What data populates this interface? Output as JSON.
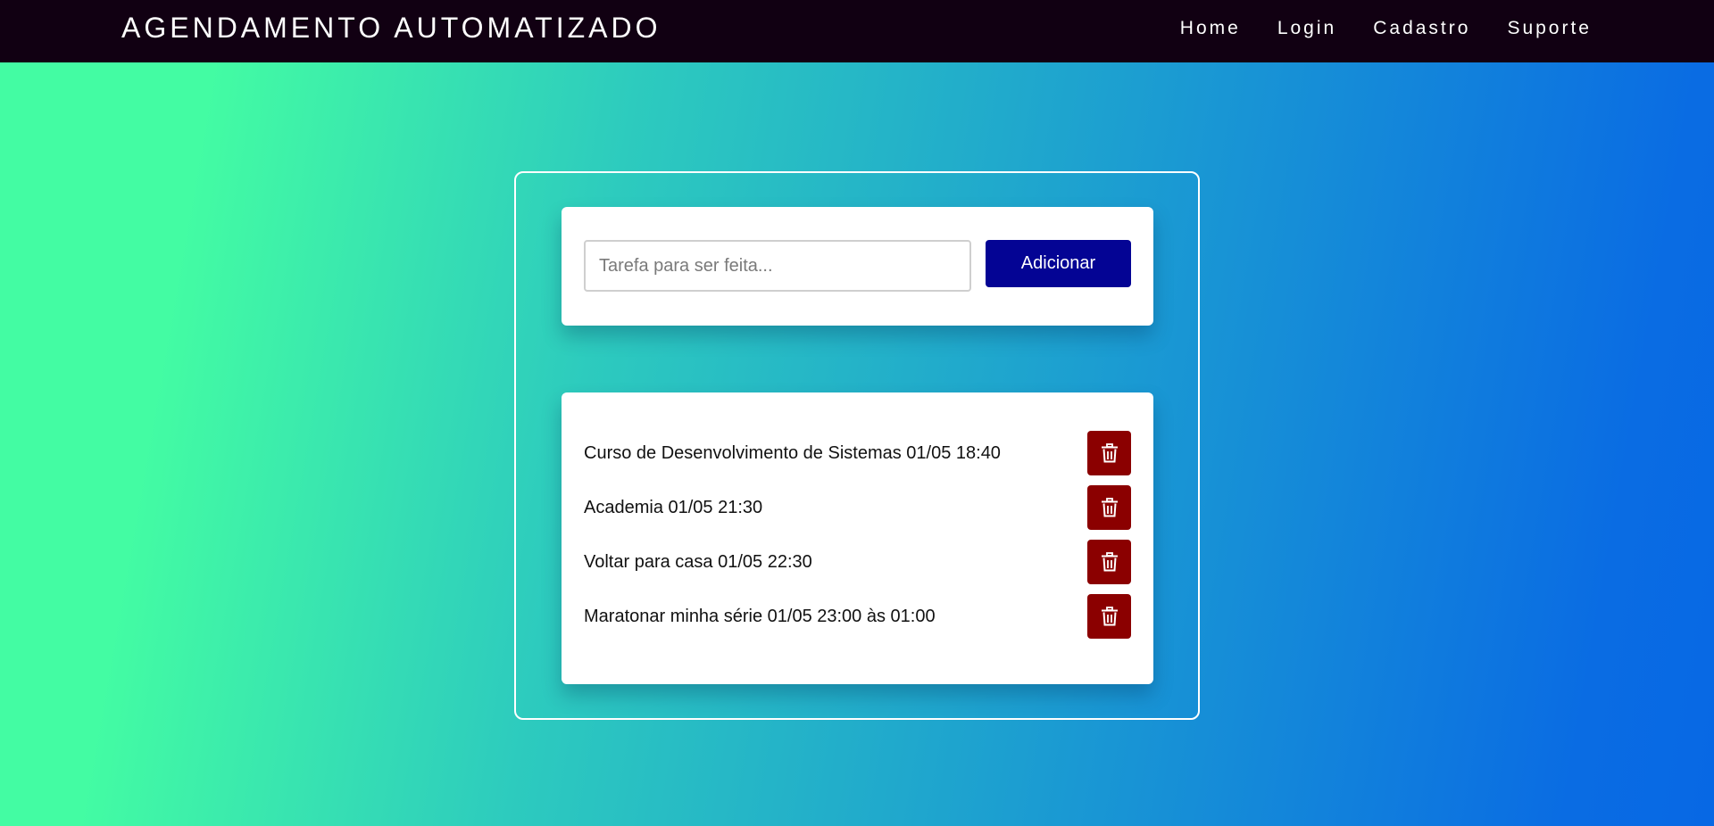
{
  "navbar": {
    "brand": "AGENDAMENTO AUTOMATIZADO",
    "links": [
      "Home",
      "Login",
      "Cadastro",
      "Suporte"
    ]
  },
  "form": {
    "placeholder": "Tarefa para ser feita...",
    "value": "",
    "add_label": "Adicionar"
  },
  "tasks": [
    {
      "text": "Curso de Desenvolvimento de Sistemas 01/05 18:40",
      "action_icon": "trash-icon"
    },
    {
      "text": "Academia 01/05 21:30",
      "action_icon": "trash-icon"
    },
    {
      "text": "Voltar para casa 01/05 22:30",
      "action_icon": "trash-icon"
    },
    {
      "text": "Maratonar minha série 01/05 23:00 às 01:00",
      "action_icon": "trash-icon"
    }
  ],
  "colors": {
    "navbar_bg": "#110012",
    "add_button": "#040494",
    "delete_button": "#8b0000",
    "gradient_start": "#43fca3",
    "gradient_end": "#0768e4"
  }
}
